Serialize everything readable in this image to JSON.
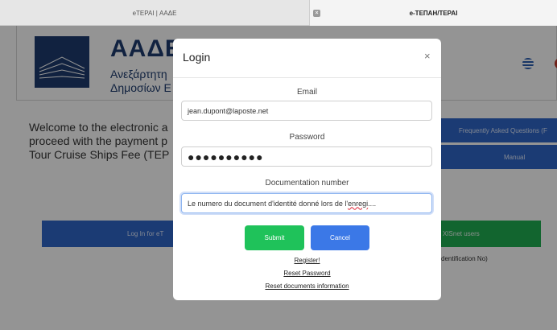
{
  "browser": {
    "tabs": [
      {
        "title": "eTEPAI | ΑΑΔΕ"
      },
      {
        "title": "e-ΤΕΠΑΗ/ΤΕΡΑΙ"
      }
    ]
  },
  "background": {
    "logo_title": "ΑΑΔΕ",
    "logo_sub_line1": "Ανεξάρτητη",
    "logo_sub_line2": "Δημοσίων Ε",
    "welcome_line1": "Welcome to the electronic a",
    "welcome_line2": "proceed with the payment p",
    "welcome_line3": "Tour Cruise Ships Fee (TEP",
    "faq_label": "Frequently Asked Questions (F",
    "manual_label": "Manual",
    "login_etepai_label": "Log In for eT",
    "taxisnet_label": "XISnet users",
    "taxisnet_sub": "dentification No)"
  },
  "modal": {
    "title": "Login",
    "close_glyph": "×",
    "email_label": "Email",
    "email_value": "jean.dupont@laposte.net",
    "password_label": "Password",
    "password_value": "●●●●●●●●●●",
    "doc_label": "Documentation number",
    "doc_value_part1": "Le numero du document d'identité donné lors de l'",
    "doc_value_squiggle": "enregi",
    "doc_value_part2": "....",
    "submit_label": "Submit",
    "cancel_label": "Cancel",
    "register_link": "Register!",
    "reset_password_link": "Reset Password",
    "reset_docs_link": "Reset documents information"
  },
  "colors": {
    "brand_navy": "#1e3c6e",
    "primary_blue": "#2f66c9",
    "success_green": "#1fc25a"
  }
}
